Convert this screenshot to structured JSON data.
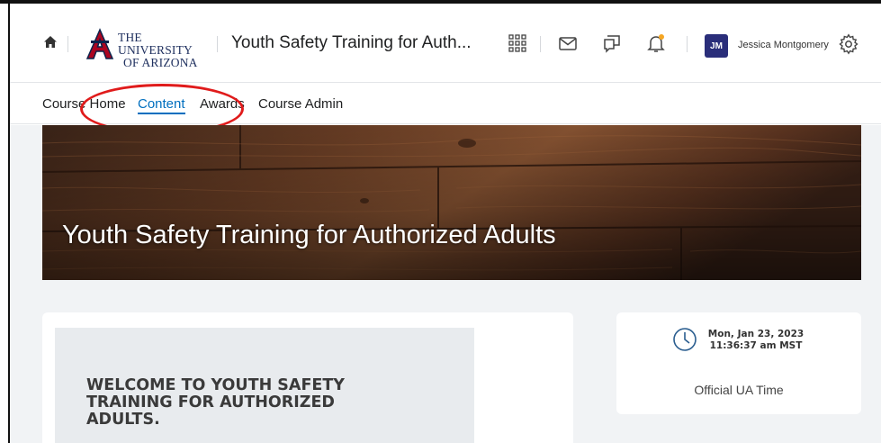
{
  "header": {
    "university_line1": "THE UNIVERSITY",
    "university_line2": "OF ARIZONA",
    "course_title": "Youth Safety Training for Auth...",
    "user_initials": "JM",
    "user_name": "Jessica Montgomery",
    "icons": [
      "home-icon",
      "waffle-grid-icon",
      "email-icon",
      "chat-icon",
      "bell-icon",
      "gear-icon"
    ],
    "notification_dot_color": "#f5a623"
  },
  "nav": {
    "items": [
      {
        "label": "Course Home"
      },
      {
        "label": "Content",
        "active": true
      },
      {
        "label": "Awards"
      },
      {
        "label": "Course Admin"
      }
    ]
  },
  "banner": {
    "title": "Youth Safety Training for Authorized Adults"
  },
  "welcome": {
    "heading": "WELCOME TO YOUTH SAFETY TRAINING FOR AUTHORIZED ADULTS."
  },
  "time_widget": {
    "date": "Mon, Jan 23, 2023",
    "time": "11:36:37 am MST",
    "caption": "Official UA Time"
  },
  "colors": {
    "accent": "#006fbf",
    "brand_red": "#ab0520",
    "brand_navy": "#0c234b",
    "annotation_red": "#e01b1b"
  }
}
